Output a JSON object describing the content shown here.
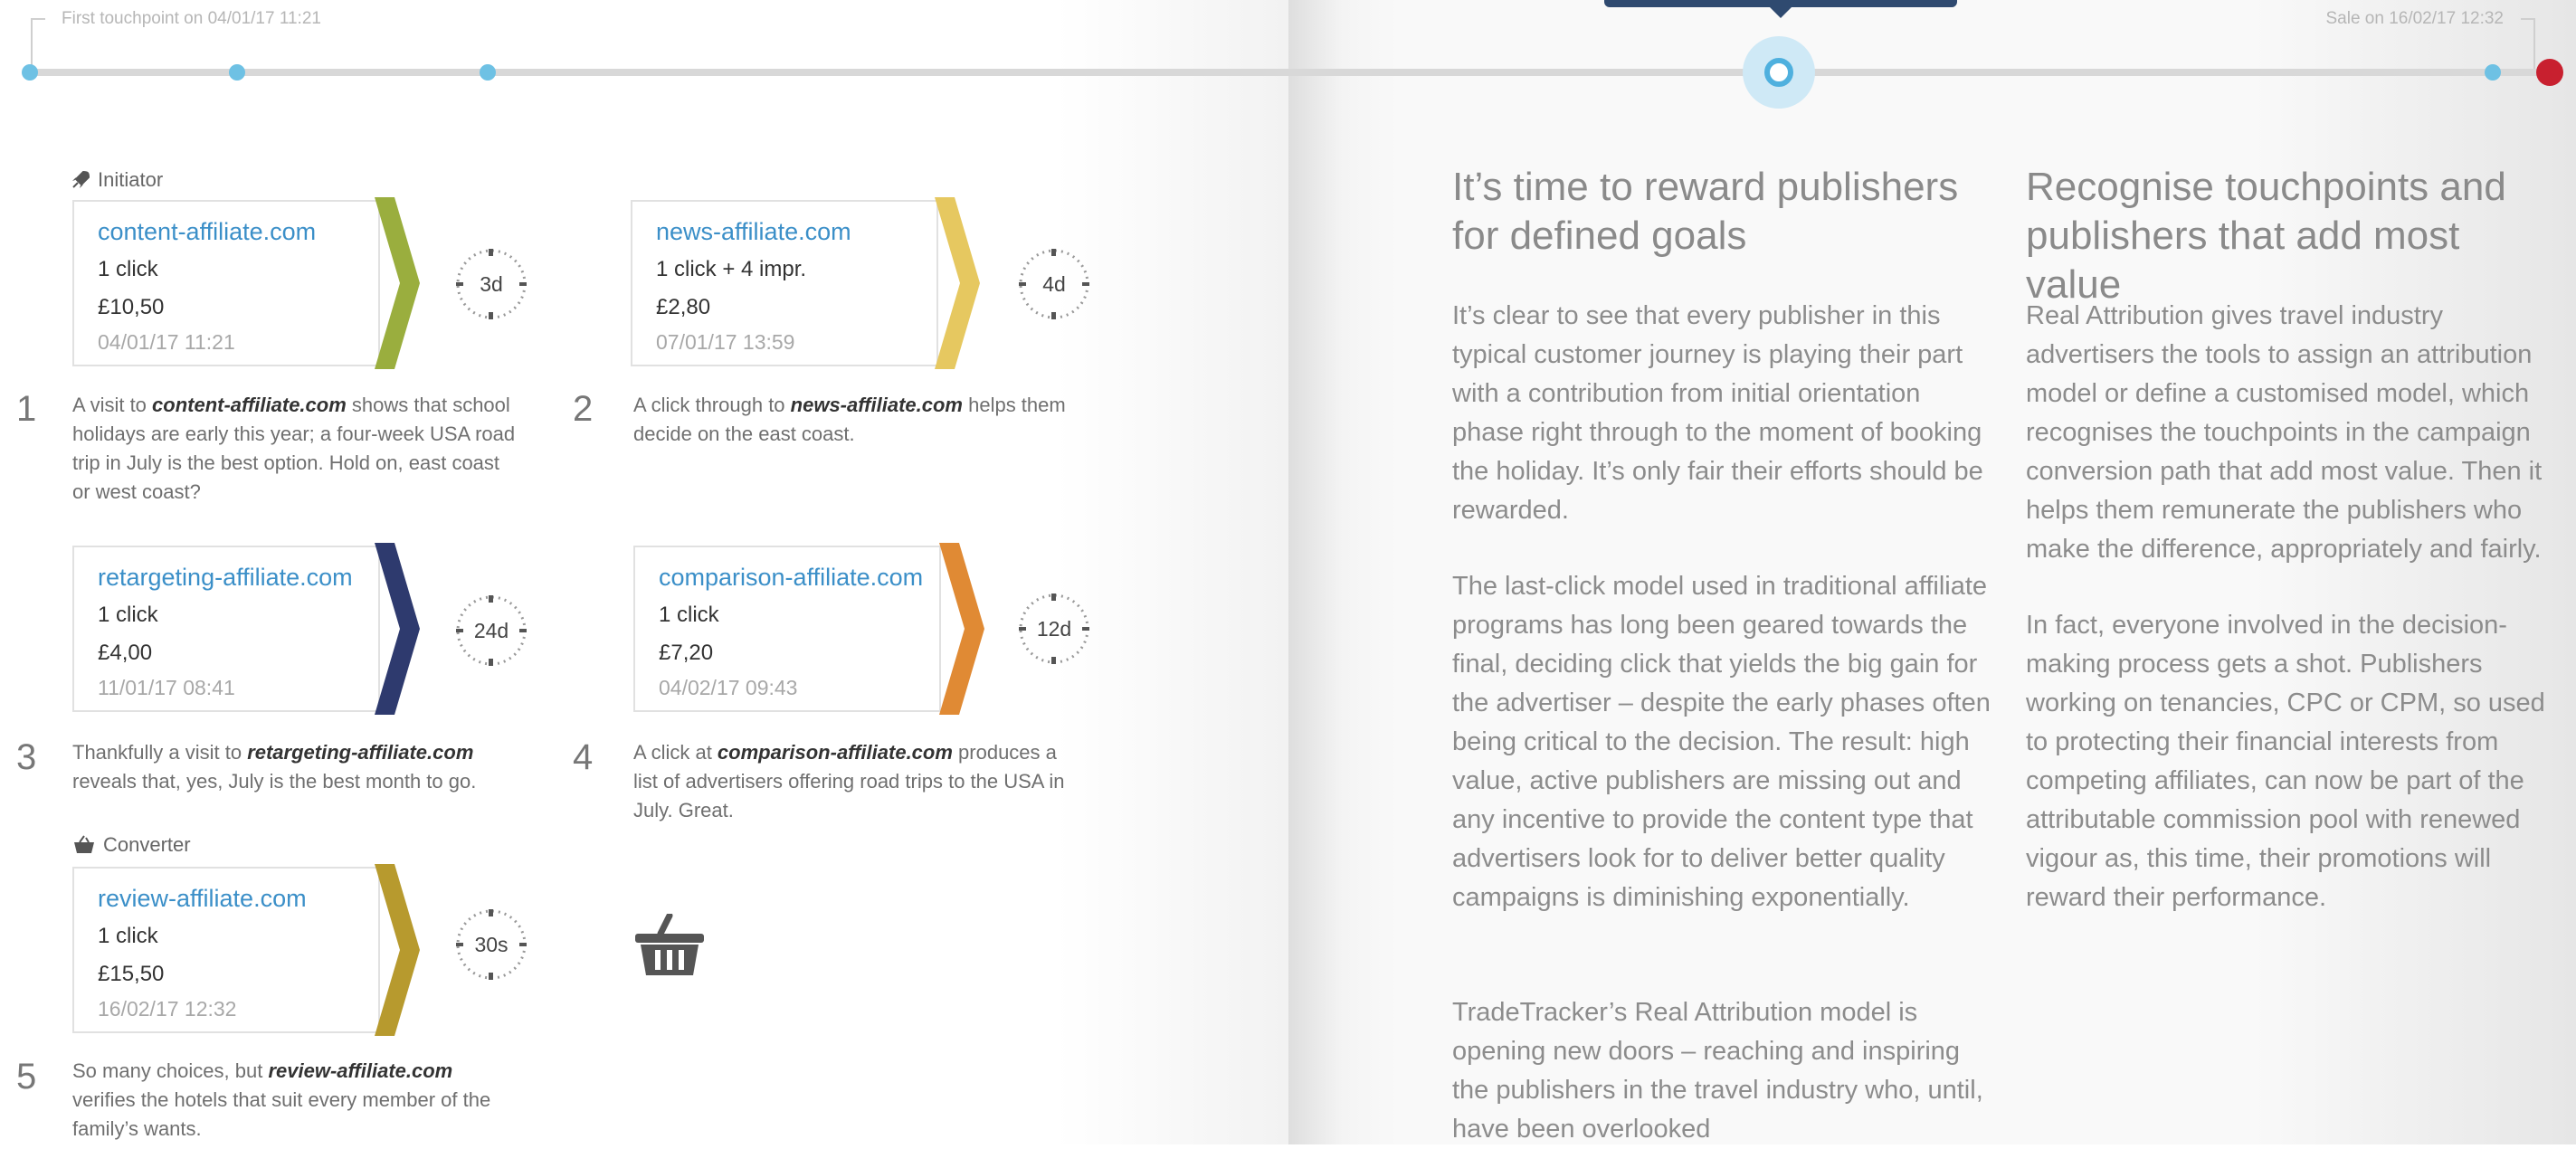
{
  "timeline": {
    "first_touchpoint": "First touchpoint on 04/01/17 11:21",
    "sale": "Sale on 16/02/17 12:32",
    "accent": "#6ec1e4",
    "sale_color": "#c8202f"
  },
  "labels": {
    "initiator": "Initiator",
    "converter": "Converter"
  },
  "steps": [
    {
      "num": "1",
      "domain": "content-affiliate.com",
      "clicks": "1 click",
      "price": "£10,50",
      "ts": "04/01/17 11:21",
      "timer": "3d",
      "color": "#9aae3e",
      "desc_pre": "A visit to ",
      "desc_em": "content-affiliate.com",
      "desc_post": " shows that school holidays are early this year; a four-week USA road trip in July is the best option. Hold on, east coast or west coast?"
    },
    {
      "num": "2",
      "domain": "news-affiliate.com",
      "clicks": "1 click + 4 impr.",
      "price": "£2,80",
      "ts": "07/01/17 13:59",
      "timer": "4d",
      "color": "#e6c860",
      "desc_pre": "A click through to ",
      "desc_em": "news-affiliate.com",
      "desc_post": " helps them decide on the east coast."
    },
    {
      "num": "3",
      "domain": "retargeting-affiliate.com",
      "clicks": "1 click",
      "price": "£4,00",
      "ts": "11/01/17 08:41",
      "timer": "24d",
      "color": "#2e3a6e",
      "desc_pre": "Thankfully a visit to ",
      "desc_em": "retargeting-affiliate.com",
      "desc_post": " reveals that, yes, July is the best month to go."
    },
    {
      "num": "4",
      "domain": "comparison-affiliate.com",
      "clicks": "1 click",
      "price": "£7,20",
      "ts": "04/02/17 09:43",
      "timer": "12d",
      "color": "#e08a34",
      "desc_pre": "A click at ",
      "desc_em": "comparison-affiliate.com",
      "desc_post": " produces a list of advertisers offering road trips to the USA in July. Great."
    },
    {
      "num": "5",
      "domain": "review-affiliate.com",
      "clicks": "1 click",
      "price": "£15,50",
      "ts": "16/02/17 12:32",
      "timer": "30s",
      "color": "#b79a2e",
      "desc_pre": "So many choices, but ",
      "desc_em": "review-affiliate.com",
      "desc_post": " verifies the hotels that suit every member of the family’s wants."
    }
  ],
  "right": {
    "col1_title": "It’s time to reward publishers for defined goals",
    "col1_p1": "It’s clear to see that every publisher in this typical customer journey is playing their part with a contribution from initial orientation phase right through to the moment of booking the holiday. It’s only fair their efforts should be rewarded.",
    "col1_p2": "The last-click model used in traditional affiliate programs has long been geared towards the final, deciding click that yields the big gain for the advertiser – despite the early phases often being critical to the decision. The result: high value, active publishers are missing out and any incentive to provide the content type that advertisers look for to deliver better quality campaigns is diminishing exponentially.",
    "col1_p3": "TradeTracker’s Real Attribution model is opening new doors – reaching and inspiring the publishers in the travel industry who, until, have been overlooked",
    "col2_title": "Recognise touchpoints and publishers that add most value",
    "col2_p1": "Real Attribution gives travel industry advertisers the tools to assign an attribution model or define a customised model, which recognises the touchpoints in the campaign conversion path that add most value. Then it helps them remunerate the publishers who make the difference, appropriately and fairly.",
    "col2_p2": "In fact, everyone involved in the decision-making process gets a shot. Publishers working on tenancies, CPC or CPM, so used to protecting their financial interests from competing affiliates, can now be part of the attributable commission pool with renewed vigour as, this time, their promotions will reward their performance."
  }
}
